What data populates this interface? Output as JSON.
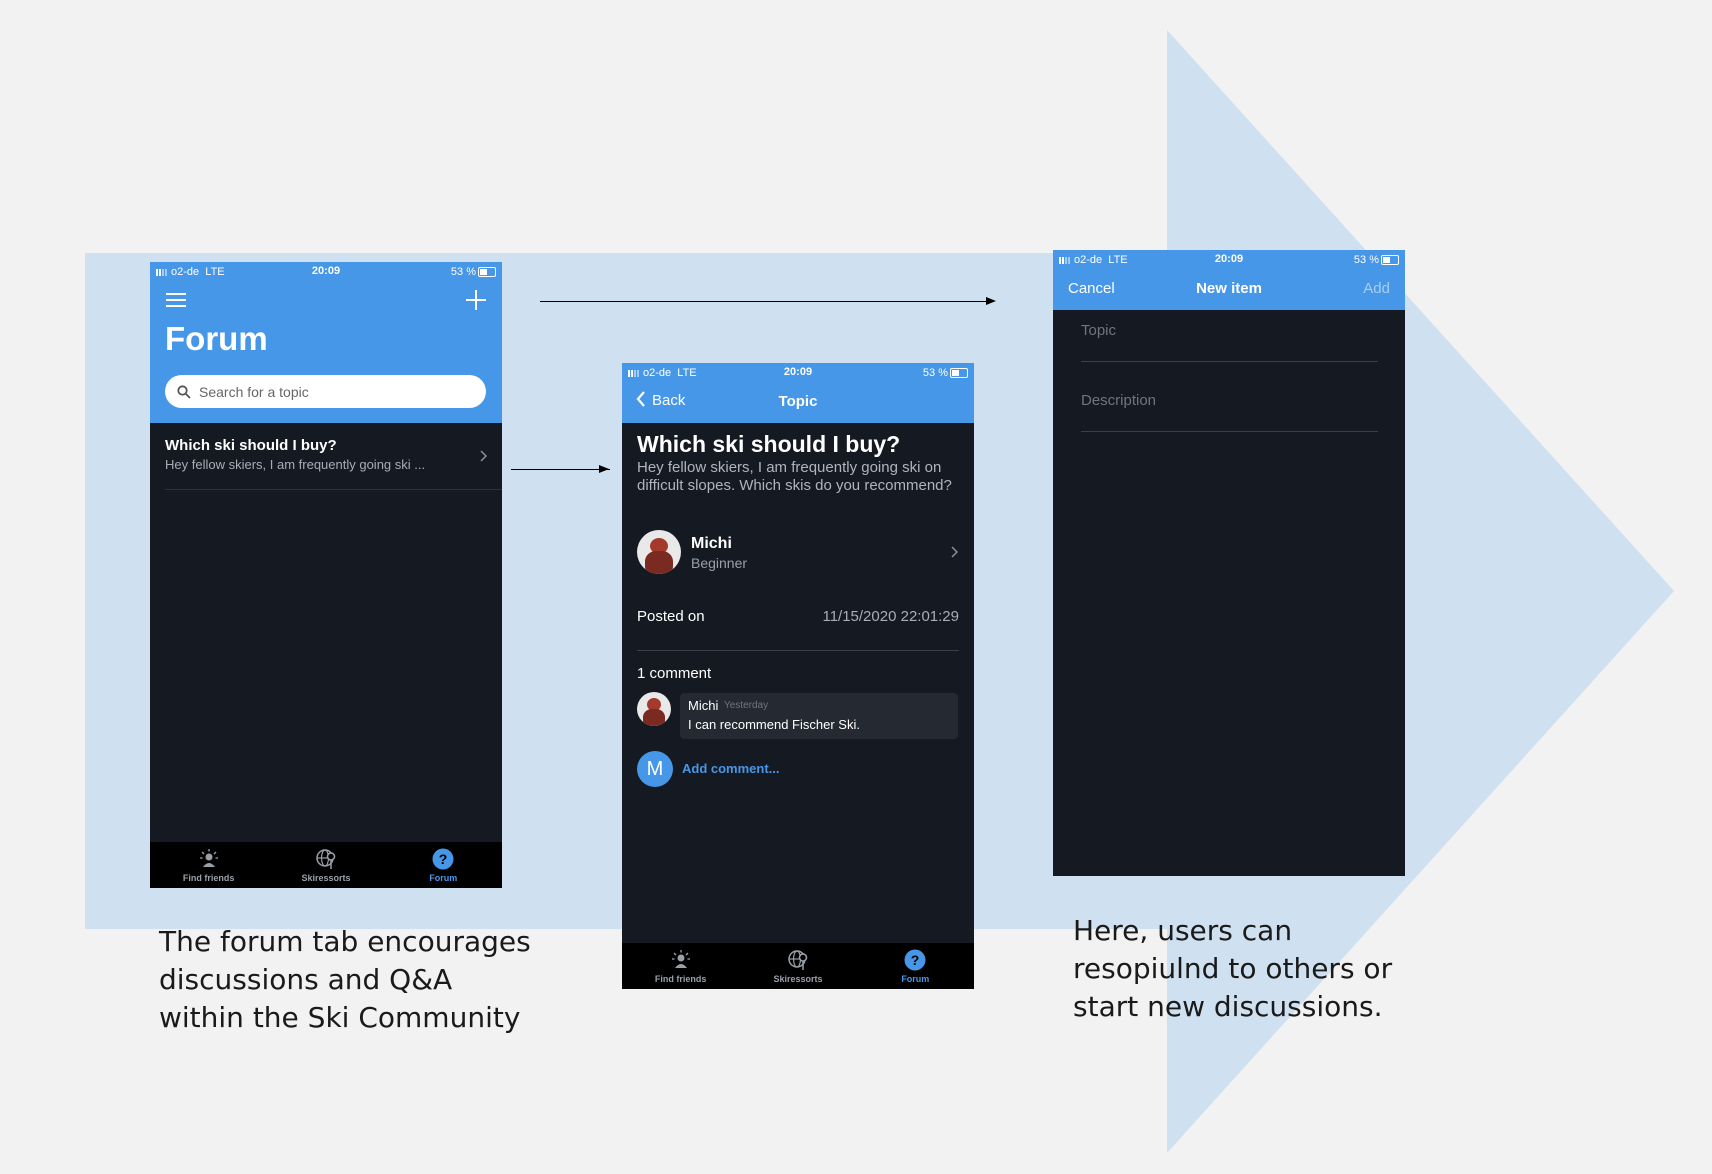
{
  "status_bar": {
    "carrier": "o2-de",
    "network": "LTE",
    "time": "20:09",
    "battery": "53 %"
  },
  "tabs": [
    {
      "label": "Find friends",
      "icon": "find-friends-icon"
    },
    {
      "label": "Skiressorts",
      "icon": "globe-pin-icon"
    },
    {
      "label": "Forum",
      "icon": "question-icon"
    }
  ],
  "screen1": {
    "title": "Forum",
    "search_placeholder": "Search for a topic",
    "topic_title": "Which ski should I buy?",
    "topic_preview": "Hey fellow skiers, I am frequently going ski ..."
  },
  "screen2": {
    "back_label": "Back",
    "nav_title": "Topic",
    "topic_title": "Which ski should I buy?",
    "topic_body": "Hey fellow skiers, I am frequently going ski on difficult slopes. Which skis do you recommend?",
    "author_name": "Michi",
    "author_level": "Beginner",
    "posted_label": "Posted on",
    "posted_value": "11/15/2020 22:01:29",
    "comment_count": "1 comment",
    "comment_author": "Michi",
    "comment_time": "Yesterday",
    "comment_text": "I can recommend Fischer Ski.",
    "user_initial": "M",
    "add_comment": "Add comment..."
  },
  "screen3": {
    "cancel": "Cancel",
    "nav_title": "New item",
    "add": "Add",
    "topic_placeholder": "Topic",
    "description_placeholder": "Description"
  },
  "captions": {
    "left": "The forum tab encourages discussions and Q&A within the Ski Community",
    "right": "Here, users can resopiulnd to others or start new discussions."
  },
  "colors": {
    "accent": "#4797e9",
    "dark": "#151922",
    "background": "#f2f2f2",
    "panel": "#cfe0f0"
  }
}
